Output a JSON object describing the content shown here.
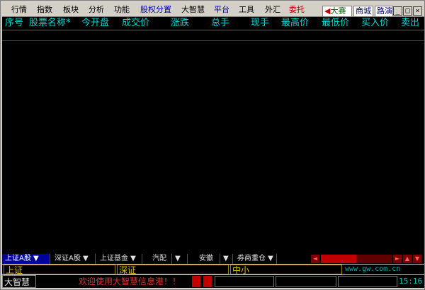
{
  "menu": {
    "items": [
      {
        "label": "行情",
        "color": "#000000"
      },
      {
        "label": "指数",
        "color": "#000000"
      },
      {
        "label": "板块",
        "color": "#000000"
      },
      {
        "label": "分析",
        "color": "#000000"
      },
      {
        "label": "功能",
        "color": "#000000"
      },
      {
        "label": "股权分置",
        "color": "#0000c0"
      },
      {
        "label": "大智慧",
        "color": "#000000"
      },
      {
        "label": "平台",
        "color": "#0000c0"
      },
      {
        "label": "工具",
        "color": "#000000"
      },
      {
        "label": "外汇",
        "color": "#000000"
      },
      {
        "label": "委托",
        "color": "#c00000"
      }
    ],
    "brand_buttons": [
      {
        "label": "大赛",
        "color": "#006000"
      },
      {
        "label": "商城",
        "color": "#000080"
      },
      {
        "label": "路演",
        "color": "#000080"
      }
    ],
    "window_controls": {
      "minimize": "_",
      "restore": "□",
      "close": "×"
    }
  },
  "table": {
    "columns": [
      "序号",
      "股票名称*",
      "今开盘",
      "成交价",
      "涨跌",
      "总手",
      "现手",
      "最高价",
      "最低价",
      "买入价",
      "卖出"
    ]
  },
  "tabs": [
    {
      "label": "上证A股 ▼",
      "active": true
    },
    {
      "label": "深证A股 ▼",
      "active": false
    },
    {
      "label": "上证基金 ▼",
      "active": false
    },
    {
      "label": "汽配",
      "active": false
    },
    {
      "label": "▼",
      "active": false
    },
    {
      "label": "安徽",
      "active": false
    },
    {
      "label": "▼",
      "active": false
    },
    {
      "label": "券商重仓 ▼",
      "active": false
    }
  ],
  "scroll": {
    "left": "◄",
    "right": "►",
    "up": "▲",
    "down": "▼"
  },
  "indices": [
    {
      "label": "上证"
    },
    {
      "label": "深证"
    },
    {
      "label": "中小"
    }
  ],
  "footer": {
    "url": "www.gw.com.cn",
    "logo_label": "大智慧",
    "ticker": "欢迎使用大智慧信息港！！",
    "clock": "15:16"
  }
}
